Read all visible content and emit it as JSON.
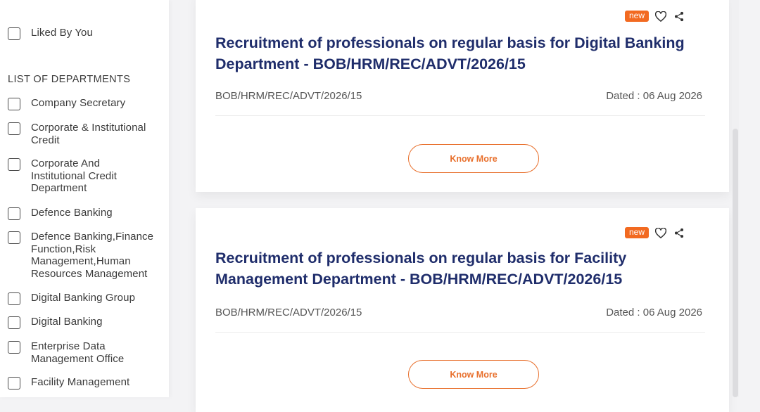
{
  "filters": {
    "liked": "Liked By You",
    "heading": "LIST OF DEPARTMENTS",
    "departments": [
      "Company Secretary",
      "Corporate & Institutional Credit",
      "Corporate And Institutional Credit Department",
      "Defence Banking",
      "Defence Banking,Finance Function,Risk Management,Human Resources Management",
      "Digital Banking Group",
      "Digital Banking",
      "Enterprise Data Management Office",
      "Facility Management"
    ]
  },
  "cards": [
    {
      "badge": "new",
      "title": "Recruitment of professionals on regular basis for Digital Banking Department - BOB/HRM/REC/ADVT/2026/15",
      "reference": "BOB/HRM/REC/ADVT/2026/15",
      "dated": "Dated : 06 Aug 2026",
      "button": "Know More"
    },
    {
      "badge": "new",
      "title": "Recruitment of professionals on regular basis for Facility Management Department - BOB/HRM/REC/ADVT/2026/15",
      "reference": "BOB/HRM/REC/ADVT/2026/15",
      "dated": "Dated : 06 Aug 2026",
      "button": "Know More"
    }
  ],
  "icons": {
    "like": "heart-icon",
    "share": "share-icon"
  },
  "colors": {
    "accent": "#f26a21",
    "title": "#1f2d6b"
  }
}
